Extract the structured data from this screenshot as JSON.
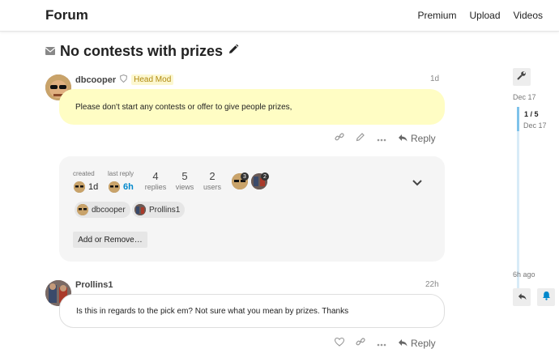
{
  "header": {
    "brand": "Forum",
    "nav": [
      "Premium",
      "Upload",
      "Videos"
    ]
  },
  "topic": {
    "title": "No contests with prizes"
  },
  "posts": [
    {
      "username": "dbcooper",
      "flair": "Head Mod",
      "age": "1d",
      "content": "Please don't start any contests or offer to give people prizes,",
      "reply_label": "Reply"
    },
    {
      "username": "Prollins1",
      "age": "22h",
      "content": "Is this in regards to the pick em? Not sure what you mean by prizes. Thanks",
      "reply_label": "Reply"
    }
  ],
  "topic_map": {
    "created_label": "created",
    "created_value": "1d",
    "last_reply_label": "last reply",
    "last_reply_value": "6h",
    "replies_num": "4",
    "replies_label": "replies",
    "views_num": "5",
    "views_label": "views",
    "users_num": "2",
    "users_label": "users",
    "avatar_badges": [
      "3",
      "2"
    ],
    "participants": [
      "dbcooper",
      "Prollins1"
    ],
    "add_button": "Add or Remove…"
  },
  "timeline": {
    "start_date": "Dec 17",
    "position": "1 / 5",
    "position_date": "Dec 17",
    "end": "6h ago"
  },
  "colors": {
    "accent": "#0088cc",
    "highlight": "#fffdc4",
    "flair_bg": "#fcf7d0",
    "flair_text": "#b08a10",
    "online": "#2ecc40"
  },
  "icons": {
    "title_prefix": "envelope-icon",
    "title_suffix": "pencil-icon",
    "wrench": "wrench-icon",
    "bell": "bell-icon"
  }
}
